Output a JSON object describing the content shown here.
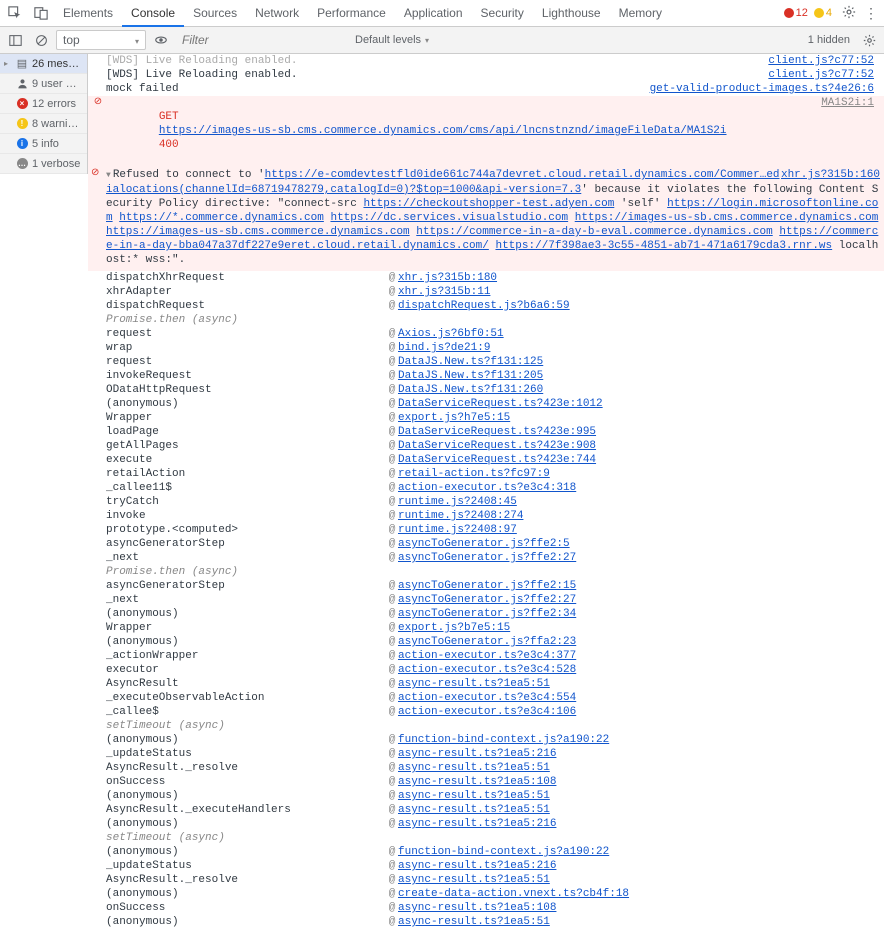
{
  "tabs": {
    "items": [
      "Elements",
      "Console",
      "Sources",
      "Network",
      "Performance",
      "Application",
      "Security",
      "Lighthouse",
      "Memory"
    ],
    "active_index": 1,
    "error_count": "12",
    "warning_count": "4"
  },
  "toolbar": {
    "context": "top",
    "filter_placeholder": "Filter",
    "levels_label": "Default levels",
    "hidden_label": "1 hidden"
  },
  "sidebar": {
    "items": [
      {
        "icon": "msg",
        "count": "26",
        "label": "messages"
      },
      {
        "icon": "user",
        "count": "9",
        "label": "user mess..."
      },
      {
        "icon": "error",
        "count": "12",
        "label": "errors"
      },
      {
        "icon": "warning",
        "count": "8",
        "label": "warnings"
      },
      {
        "icon": "info",
        "count": "5",
        "label": "info"
      },
      {
        "icon": "verbose",
        "count": "1",
        "label": "verbose"
      }
    ],
    "selected_index": 0
  },
  "log_rows": [
    {
      "type": "log",
      "text": "[WDS] Live Reloading enabled.",
      "src": "client.js?c77:52",
      "src_link": true,
      "gray_text": true
    },
    {
      "type": "log",
      "text": "[WDS] Live Reloading enabled.",
      "src": "client.js?c77:52",
      "src_link": true
    },
    {
      "type": "log",
      "text": "mock failed",
      "src": "get-valid-product-images.ts?4e26:6",
      "src_link": true
    }
  ],
  "error_row": {
    "method": "GET",
    "url": "https://images-us-sb.cms.commerce.dynamics.com/cms/api/lncnstnznd/imageFileData/MA1S2i",
    "code": "400",
    "src": "MA1S2i:1"
  },
  "csp": {
    "src": "xhr.js?315b:160",
    "prefix": "Refused to connect to '",
    "target_url": "https://e-comdevtestfld0ide661c744a7devret.cloud.retail.dynamics.com/Commer…edialocations(channelId=68719478279,catalogId=0)?$top=1000&api-version=7.3",
    "mid": "' because it violates the following Content Security Policy directive: \"connect-src",
    "allowed": [
      "https://checkoutshopper-test.adyen.com",
      "'self'",
      "https://login.microsoftonline.com",
      "https://*.commerce.dynamics.com",
      "https://dc.services.visualstudio.com",
      "https://images-us-sb.cms.commerce.dynamics.com",
      "https://images-us-sb.cms.commerce.dynamics.com",
      "https://commerce-in-a-day-b-eval.commerce.dynamics.com",
      "https://commerce-in-a-day-bba047a37df227e9eret.cloud.retail.dynamics.com/",
      "https://7f398ae3-3c55-4851-ab71-471a6179cda3.rnr.ws",
      "localhost:* wss:"
    ],
    "tail": "\"."
  },
  "stack": [
    {
      "fn": "dispatchXhrRequest",
      "loc": "xhr.js?315b:180"
    },
    {
      "fn": "xhrAdapter",
      "loc": "xhr.js?315b:11"
    },
    {
      "fn": "dispatchRequest",
      "loc": "dispatchRequest.js?b6a6:59"
    },
    {
      "section": "Promise.then (async)"
    },
    {
      "fn": "request",
      "loc": "Axios.js?6bf0:51"
    },
    {
      "fn": "wrap",
      "loc": "bind.js?de21:9"
    },
    {
      "fn": "request",
      "loc": "DataJS.New.ts?f131:125"
    },
    {
      "fn": "invokeRequest",
      "loc": "DataJS.New.ts?f131:205"
    },
    {
      "fn": "ODataHttpRequest",
      "loc": "DataJS.New.ts?f131:260"
    },
    {
      "fn": "(anonymous)",
      "loc": "DataServiceRequest.ts?423e:1012"
    },
    {
      "fn": "Wrapper",
      "loc": "export.js?h7e5:15"
    },
    {
      "fn": "loadPage",
      "loc": "DataServiceRequest.ts?423e:995"
    },
    {
      "fn": "getAllPages",
      "loc": "DataServiceRequest.ts?423e:908"
    },
    {
      "fn": "execute",
      "loc": "DataServiceRequest.ts?423e:744"
    },
    {
      "fn": "retailAction",
      "loc": "retail-action.ts?fc97:9"
    },
    {
      "fn": "_callee11$",
      "loc": "action-executor.ts?e3c4:318"
    },
    {
      "fn": "tryCatch",
      "loc": "runtime.js?2408:45"
    },
    {
      "fn": "invoke",
      "loc": "runtime.js?2408:274"
    },
    {
      "fn": "prototype.<computed>",
      "loc": "runtime.js?2408:97"
    },
    {
      "fn": "asyncGeneratorStep",
      "loc": "asyncToGenerator.js?ffe2:5"
    },
    {
      "fn": "_next",
      "loc": "asyncToGenerator.js?ffe2:27"
    },
    {
      "section": "Promise.then (async)"
    },
    {
      "fn": "asyncGeneratorStep",
      "loc": "asyncToGenerator.js?ffe2:15"
    },
    {
      "fn": "_next",
      "loc": "asyncToGenerator.js?ffe2:27"
    },
    {
      "fn": "(anonymous)",
      "loc": "asyncToGenerator.js?ffe2:34"
    },
    {
      "fn": "Wrapper",
      "loc": "export.js?b7e5:15"
    },
    {
      "fn": "(anonymous)",
      "loc": "asyncToGenerator.js?ffa2:23"
    },
    {
      "fn": "_actionWrapper",
      "loc": "action-executor.ts?e3c4:377"
    },
    {
      "fn": "executor",
      "loc": "action-executor.ts?e3c4:528"
    },
    {
      "fn": "AsyncResult",
      "loc": "async-result.ts?1ea5:51"
    },
    {
      "fn": "_executeObservableAction",
      "loc": "action-executor.ts?e3c4:554"
    },
    {
      "fn": "_callee$",
      "loc": "action-executor.ts?e3c4:106"
    },
    {
      "section": "setTimeout (async)"
    },
    {
      "fn": "(anonymous)",
      "loc": "function-bind-context.js?a190:22"
    },
    {
      "fn": "_updateStatus",
      "loc": "async-result.ts?1ea5:216"
    },
    {
      "fn": "AsyncResult._resolve",
      "loc": "async-result.ts?1ea5:51"
    },
    {
      "fn": "onSuccess",
      "loc": "async-result.ts?1ea5:108"
    },
    {
      "fn": "(anonymous)",
      "loc": "async-result.ts?1ea5:51"
    },
    {
      "fn": "AsyncResult._executeHandlers",
      "loc": "async-result.ts?1ea5:51"
    },
    {
      "fn": "(anonymous)",
      "loc": "async-result.ts?1ea5:216"
    },
    {
      "section": "setTimeout (async)"
    },
    {
      "fn": "(anonymous)",
      "loc": "function-bind-context.js?a190:22"
    },
    {
      "fn": "_updateStatus",
      "loc": "async-result.ts?1ea5:216"
    },
    {
      "fn": "AsyncResult._resolve",
      "loc": "async-result.ts?1ea5:51"
    },
    {
      "fn": "(anonymous)",
      "loc": "create-data-action.vnext.ts?cb4f:18"
    },
    {
      "fn": "onSuccess",
      "loc": "async-result.ts?1ea5:108"
    },
    {
      "fn": "(anonymous)",
      "loc": "async-result.ts?1ea5:51"
    }
  ]
}
